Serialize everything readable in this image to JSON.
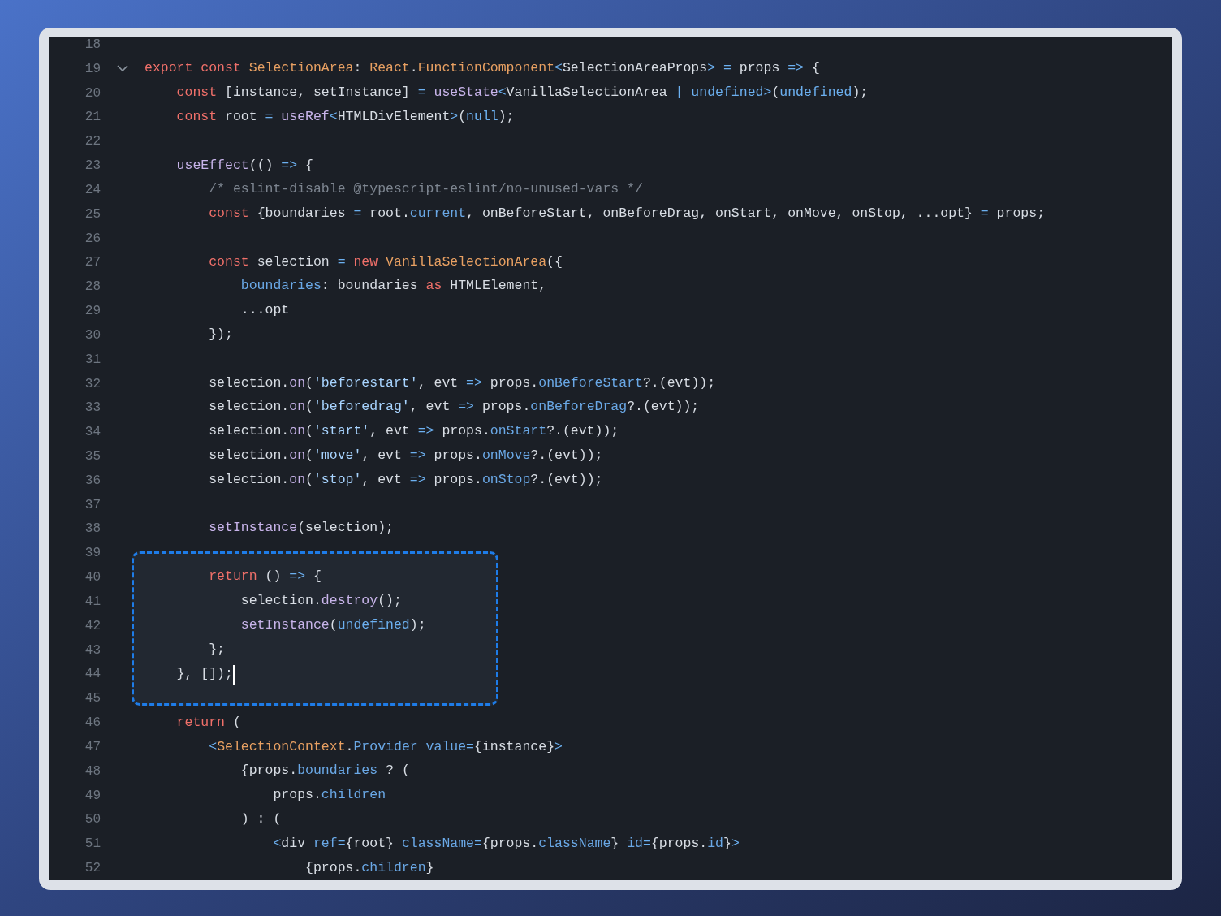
{
  "lines": [
    {
      "kind": "line",
      "number": "18"
    },
    {
      "kind": "fold_line",
      "number": "19",
      "tokens": [
        {
          "kind": "keyword",
          "text": "export const "
        },
        {
          "kind": "type",
          "text": "SelectionArea"
        },
        {
          "kind": "plain",
          "text": ": "
        },
        {
          "kind": "type",
          "text": "React"
        },
        {
          "kind": "plain",
          "text": "."
        },
        {
          "kind": "type",
          "text": "FunctionComponent"
        },
        {
          "kind": "operator",
          "text": "<"
        },
        {
          "kind": "plain",
          "text": "SelectionAreaProps"
        },
        {
          "kind": "operator",
          "text": ">"
        },
        {
          "kind": "operator",
          "text": " ="
        },
        {
          "kind": "plain",
          "text": " props "
        },
        {
          "kind": "operator",
          "text": "=>"
        },
        {
          "kind": "plain",
          "text": " {"
        }
      ]
    },
    {
      "kind": "line",
      "number": "20",
      "tokens": [
        {
          "kind": "keyword",
          "text": "    const"
        },
        {
          "kind": "plain",
          "text": " [instance, setInstance] "
        },
        {
          "kind": "operator",
          "text": "="
        },
        {
          "kind": "function",
          "text": " useState"
        },
        {
          "kind": "operator",
          "text": "<"
        },
        {
          "kind": "plain",
          "text": "VanillaSelectionArea "
        },
        {
          "kind": "operator",
          "text": "|"
        },
        {
          "kind": "constant",
          "text": " undefined"
        },
        {
          "kind": "operator",
          "text": ">"
        },
        {
          "kind": "plain",
          "text": "("
        },
        {
          "kind": "constant",
          "text": "undefined"
        },
        {
          "kind": "plain",
          "text": ");"
        }
      ]
    },
    {
      "kind": "line",
      "number": "21",
      "tokens": [
        {
          "kind": "keyword",
          "text": "    const"
        },
        {
          "kind": "plain",
          "text": " root "
        },
        {
          "kind": "operator",
          "text": "="
        },
        {
          "kind": "function",
          "text": " useRef"
        },
        {
          "kind": "operator",
          "text": "<"
        },
        {
          "kind": "plain",
          "text": "HTMLDivElement"
        },
        {
          "kind": "operator",
          "text": ">"
        },
        {
          "kind": "plain",
          "text": "("
        },
        {
          "kind": "constant",
          "text": "null"
        },
        {
          "kind": "plain",
          "text": ");"
        }
      ]
    },
    {
      "kind": "line",
      "number": "22"
    },
    {
      "kind": "line",
      "number": "23",
      "tokens": [
        {
          "kind": "function",
          "text": "    useEffect"
        },
        {
          "kind": "plain",
          "text": "(() "
        },
        {
          "kind": "operator",
          "text": "=>"
        },
        {
          "kind": "plain",
          "text": " {"
        }
      ]
    },
    {
      "kind": "line",
      "number": "24",
      "tokens": [
        {
          "kind": "comment",
          "text": "        /* eslint-disable @typescript-eslint/no-unused-vars */"
        }
      ]
    },
    {
      "kind": "line",
      "number": "25",
      "tokens": [
        {
          "kind": "keyword",
          "text": "        const"
        },
        {
          "kind": "plain",
          "text": " {boundaries "
        },
        {
          "kind": "operator",
          "text": "="
        },
        {
          "kind": "plain",
          "text": " root."
        },
        {
          "kind": "property",
          "text": "current"
        },
        {
          "kind": "plain",
          "text": ", onBeforeStart, onBeforeDrag, onStart, onMove, onStop, ...opt} "
        },
        {
          "kind": "operator",
          "text": "="
        },
        {
          "kind": "plain",
          "text": " props;"
        }
      ]
    },
    {
      "kind": "line",
      "number": "26"
    },
    {
      "kind": "line",
      "number": "27",
      "tokens": [
        {
          "kind": "keyword",
          "text": "        const"
        },
        {
          "kind": "plain",
          "text": " selection "
        },
        {
          "kind": "operator",
          "text": "="
        },
        {
          "kind": "keyword",
          "text": " new"
        },
        {
          "kind": "type",
          "text": " VanillaSelectionArea"
        },
        {
          "kind": "plain",
          "text": "({"
        }
      ]
    },
    {
      "kind": "line",
      "number": "28",
      "tokens": [
        {
          "kind": "property",
          "text": "            boundaries"
        },
        {
          "kind": "plain",
          "text": ": boundaries "
        },
        {
          "kind": "keyword",
          "text": "as"
        },
        {
          "kind": "plain",
          "text": " HTMLElement,"
        }
      ]
    },
    {
      "kind": "line",
      "number": "29",
      "tokens": [
        {
          "kind": "plain",
          "text": "            ...opt"
        }
      ]
    },
    {
      "kind": "line",
      "number": "30",
      "tokens": [
        {
          "kind": "plain",
          "text": "        });"
        }
      ]
    },
    {
      "kind": "line",
      "number": "31"
    },
    {
      "kind": "line",
      "number": "32",
      "tokens": [
        {
          "kind": "plain",
          "text": "        selection."
        },
        {
          "kind": "function",
          "text": "on"
        },
        {
          "kind": "plain",
          "text": "("
        },
        {
          "kind": "string",
          "text": "'beforestart'"
        },
        {
          "kind": "plain",
          "text": ", evt "
        },
        {
          "kind": "operator",
          "text": "=>"
        },
        {
          "kind": "plain",
          "text": " props."
        },
        {
          "kind": "property",
          "text": "onBeforeStart"
        },
        {
          "kind": "plain",
          "text": "?.(evt));"
        }
      ]
    },
    {
      "kind": "line",
      "number": "33",
      "tokens": [
        {
          "kind": "plain",
          "text": "        selection."
        },
        {
          "kind": "function",
          "text": "on"
        },
        {
          "kind": "plain",
          "text": "("
        },
        {
          "kind": "string",
          "text": "'beforedrag'"
        },
        {
          "kind": "plain",
          "text": ", evt "
        },
        {
          "kind": "operator",
          "text": "=>"
        },
        {
          "kind": "plain",
          "text": " props."
        },
        {
          "kind": "property",
          "text": "onBeforeDrag"
        },
        {
          "kind": "plain",
          "text": "?.(evt));"
        }
      ]
    },
    {
      "kind": "line",
      "number": "34",
      "tokens": [
        {
          "kind": "plain",
          "text": "        selection."
        },
        {
          "kind": "function",
          "text": "on"
        },
        {
          "kind": "plain",
          "text": "("
        },
        {
          "kind": "string",
          "text": "'start'"
        },
        {
          "kind": "plain",
          "text": ", evt "
        },
        {
          "kind": "operator",
          "text": "=>"
        },
        {
          "kind": "plain",
          "text": " props."
        },
        {
          "kind": "property",
          "text": "onStart"
        },
        {
          "kind": "plain",
          "text": "?.(evt));"
        }
      ]
    },
    {
      "kind": "line",
      "number": "35",
      "tokens": [
        {
          "kind": "plain",
          "text": "        selection."
        },
        {
          "kind": "function",
          "text": "on"
        },
        {
          "kind": "plain",
          "text": "("
        },
        {
          "kind": "string",
          "text": "'move'"
        },
        {
          "kind": "plain",
          "text": ", evt "
        },
        {
          "kind": "operator",
          "text": "=>"
        },
        {
          "kind": "plain",
          "text": " props."
        },
        {
          "kind": "property",
          "text": "onMove"
        },
        {
          "kind": "plain",
          "text": "?.(evt));"
        }
      ]
    },
    {
      "kind": "line",
      "number": "36",
      "tokens": [
        {
          "kind": "plain",
          "text": "        selection."
        },
        {
          "kind": "function",
          "text": "on"
        },
        {
          "kind": "plain",
          "text": "("
        },
        {
          "kind": "string",
          "text": "'stop'"
        },
        {
          "kind": "plain",
          "text": ", evt "
        },
        {
          "kind": "operator",
          "text": "=>"
        },
        {
          "kind": "plain",
          "text": " props."
        },
        {
          "kind": "property",
          "text": "onStop"
        },
        {
          "kind": "plain",
          "text": "?.(evt));"
        }
      ]
    },
    {
      "kind": "line",
      "number": "37"
    },
    {
      "kind": "line",
      "number": "38",
      "tokens": [
        {
          "kind": "function",
          "text": "        setInstance"
        },
        {
          "kind": "plain",
          "text": "(selection);"
        }
      ]
    },
    {
      "kind": "line",
      "number": "39"
    },
    {
      "kind": "highlight_box",
      "lines": [
        {
          "number": "40",
          "tokens": [
            {
              "kind": "keyword",
              "text": "        return"
            },
            {
              "kind": "plain",
              "text": " () "
            },
            {
              "kind": "operator",
              "text": "=>"
            },
            {
              "kind": "plain",
              "text": " {"
            }
          ]
        },
        {
          "number": "41",
          "tokens": [
            {
              "kind": "plain",
              "text": "            selection."
            },
            {
              "kind": "function",
              "text": "destroy"
            },
            {
              "kind": "plain",
              "text": "();"
            }
          ]
        },
        {
          "number": "42",
          "tokens": [
            {
              "kind": "function",
              "text": "            setInstance"
            },
            {
              "kind": "plain",
              "text": "("
            },
            {
              "kind": "constant",
              "text": "undefined"
            },
            {
              "kind": "plain",
              "text": ");"
            }
          ]
        },
        {
          "number": "43",
          "tokens": [
            {
              "kind": "plain",
              "text": "        };"
            }
          ]
        },
        {
          "number": "44",
          "tokens": [
            {
              "kind": "plain",
              "text": "    }, []);"
            },
            {
              "kind": "caret"
            }
          ]
        }
      ]
    },
    {
      "kind": "line",
      "number": "45"
    },
    {
      "kind": "line",
      "number": "46",
      "tokens": [
        {
          "kind": "keyword",
          "text": "    return"
        },
        {
          "kind": "plain",
          "text": " ("
        }
      ]
    },
    {
      "kind": "line",
      "number": "47",
      "tokens": [
        {
          "kind": "operator",
          "text": "        <"
        },
        {
          "kind": "type",
          "text": "SelectionContext"
        },
        {
          "kind": "plain",
          "text": "."
        },
        {
          "kind": "property",
          "text": "Provider"
        },
        {
          "kind": "property",
          "text": " value"
        },
        {
          "kind": "operator",
          "text": "="
        },
        {
          "kind": "plain",
          "text": "{instance}"
        },
        {
          "kind": "operator",
          "text": ">"
        }
      ]
    },
    {
      "kind": "line",
      "number": "48",
      "tokens": [
        {
          "kind": "plain",
          "text": "            {props."
        },
        {
          "kind": "property",
          "text": "boundaries"
        },
        {
          "kind": "plain",
          "text": " ? ("
        }
      ]
    },
    {
      "kind": "line",
      "number": "49",
      "tokens": [
        {
          "kind": "plain",
          "text": "                props."
        },
        {
          "kind": "property",
          "text": "children"
        }
      ]
    },
    {
      "kind": "line",
      "number": "50",
      "tokens": [
        {
          "kind": "plain",
          "text": "            ) : ("
        }
      ]
    },
    {
      "kind": "line",
      "number": "51",
      "tokens": [
        {
          "kind": "operator",
          "text": "                <"
        },
        {
          "kind": "plain",
          "text": "div "
        },
        {
          "kind": "property",
          "text": "ref"
        },
        {
          "kind": "operator",
          "text": "="
        },
        {
          "kind": "plain",
          "text": "{root} "
        },
        {
          "kind": "property",
          "text": "className"
        },
        {
          "kind": "operator",
          "text": "="
        },
        {
          "kind": "plain",
          "text": "{props."
        },
        {
          "kind": "property",
          "text": "className"
        },
        {
          "kind": "plain",
          "text": "} "
        },
        {
          "kind": "property",
          "text": "id"
        },
        {
          "kind": "operator",
          "text": "="
        },
        {
          "kind": "plain",
          "text": "{props."
        },
        {
          "kind": "property",
          "text": "id"
        },
        {
          "kind": "plain",
          "text": "}"
        },
        {
          "kind": "operator",
          "text": ">"
        }
      ]
    },
    {
      "kind": "line",
      "number": "52",
      "tokens": [
        {
          "kind": "plain",
          "text": "                    {props."
        },
        {
          "kind": "property",
          "text": "children"
        },
        {
          "kind": "plain",
          "text": "}"
        }
      ]
    }
  ]
}
